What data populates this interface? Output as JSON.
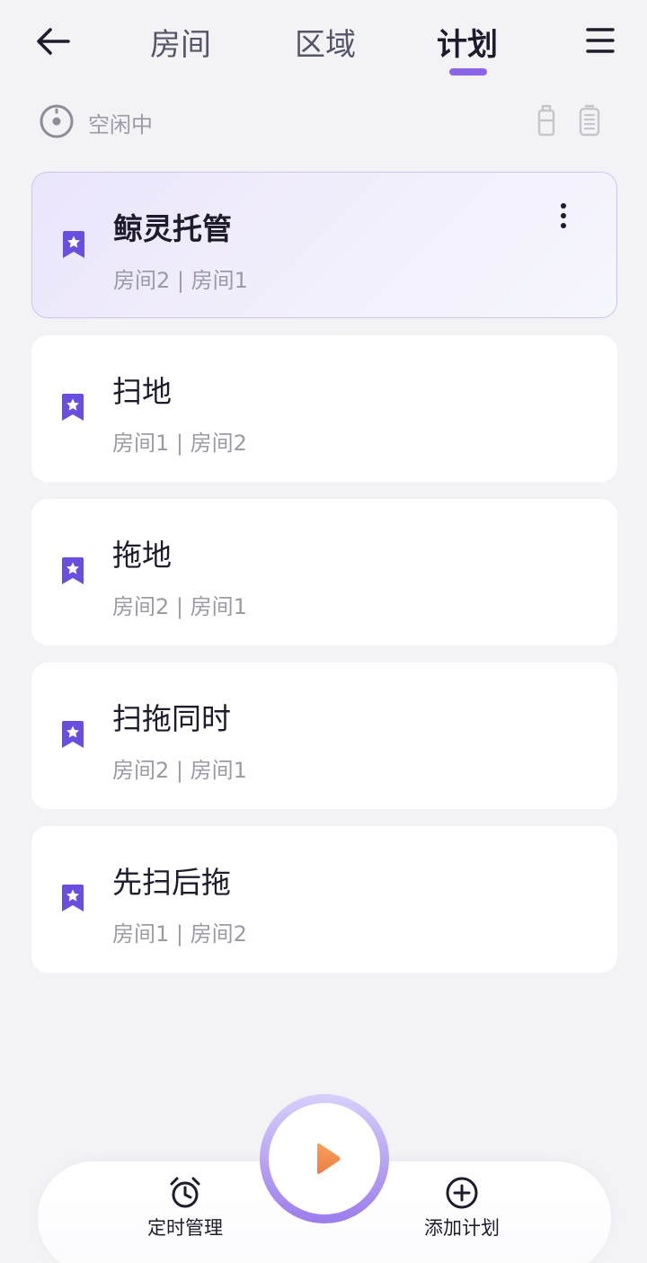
{
  "header": {
    "tabs": [
      {
        "label": "房间",
        "active": false
      },
      {
        "label": "区域",
        "active": false
      },
      {
        "label": "计划",
        "active": true
      }
    ]
  },
  "status": {
    "text": "空闲中"
  },
  "plans": [
    {
      "name": "鲸灵托管",
      "rooms": "房间2 | 房间1",
      "featured": true
    },
    {
      "name": "扫地",
      "rooms": "房间1 | 房间2",
      "featured": false
    },
    {
      "name": "拖地",
      "rooms": "房间2 | 房间1",
      "featured": false
    },
    {
      "name": "扫拖同时",
      "rooms": "房间2 | 房间1",
      "featured": false
    },
    {
      "name": "先扫后拖",
      "rooms": "房间1 | 房间2",
      "featured": false
    }
  ],
  "bottom_bar": {
    "schedule_label": "定时管理",
    "add_label": "添加计划"
  },
  "colors": {
    "accent": "#8b64e8",
    "bookmark": "#6a4ee0",
    "play": "#f08a4b"
  }
}
